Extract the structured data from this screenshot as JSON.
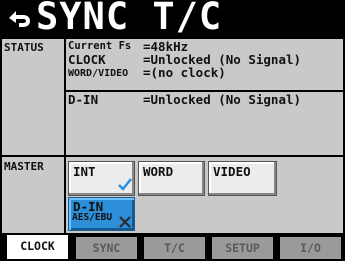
{
  "title": "SYNC T/C",
  "status": {
    "label": "STATUS",
    "rows": [
      {
        "key": "Current Fs",
        "value": "=48kHz"
      },
      {
        "key": "CLOCK",
        "value": "=Unlocked (No Signal)"
      },
      {
        "key": "WORD/VIDEO",
        "value": "=(no clock)"
      },
      {
        "key": "D-IN",
        "value": "=Unlocked (No Signal)"
      }
    ]
  },
  "master": {
    "label": "MASTER",
    "buttons": [
      {
        "label": "INT",
        "sub": "",
        "selected": false,
        "checked": true
      },
      {
        "label": "WORD",
        "sub": "",
        "selected": false,
        "checked": false
      },
      {
        "label": "VIDEO",
        "sub": "",
        "selected": false,
        "checked": false
      },
      {
        "label": "D-IN",
        "sub": "AES/EBU",
        "selected": true,
        "checked": false,
        "unavailable": true
      }
    ]
  },
  "tabs": [
    {
      "label": "CLOCK",
      "active": true
    },
    {
      "label": "SYNC",
      "active": false
    },
    {
      "label": "T/C",
      "active": false
    },
    {
      "label": "SETUP",
      "active": false
    },
    {
      "label": "I/O",
      "active": false
    }
  ],
  "colors": {
    "selected_button": "#2d8fd8",
    "check_mark": "#2d8fd8",
    "panel_bg": "#c9c9c9",
    "frame": "#000000"
  }
}
